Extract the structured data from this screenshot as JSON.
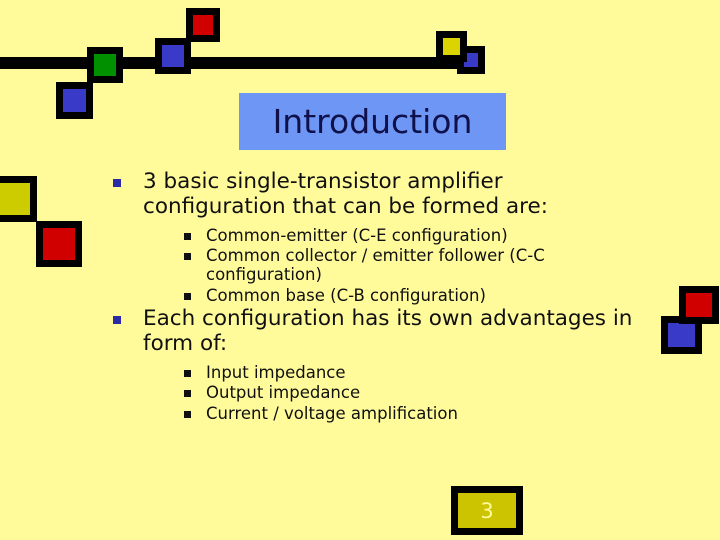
{
  "slide": {
    "background_color": "#FFFB9B",
    "title": "Introduction",
    "title_background": "#6E96F5",
    "page_number": "3"
  },
  "decorations": {
    "top_bar_color": "#000000",
    "squares": [
      {
        "name": "red-top",
        "color": "#D00000"
      },
      {
        "name": "blue-top",
        "color": "#3A3AC8"
      },
      {
        "name": "green-top",
        "color": "#009000"
      },
      {
        "name": "blue-low",
        "color": "#3A3AC8"
      },
      {
        "name": "yellow-right",
        "color": "#DCD400"
      },
      {
        "name": "blue-right",
        "color": "#3A3AC8"
      },
      {
        "name": "olive-left",
        "color": "#CCCC00"
      },
      {
        "name": "red-left",
        "color": "#D00000"
      },
      {
        "name": "red-right2",
        "color": "#D00000"
      },
      {
        "name": "blue-right2",
        "color": "#3A3AC8"
      }
    ]
  },
  "content": {
    "bullets": [
      {
        "text": "3 basic single-transistor amplifier configuration that can be formed are:",
        "sub": [
          "Common-emitter (C-E configuration)",
          "Common collector / emitter follower (C-C configuration)",
          "Common base (C-B configuration)"
        ]
      },
      {
        "text": "Each configuration has its own advantages in form of:",
        "sub": [
          "Input impedance",
          "Output impedance",
          "Current / voltage amplification"
        ]
      }
    ]
  }
}
